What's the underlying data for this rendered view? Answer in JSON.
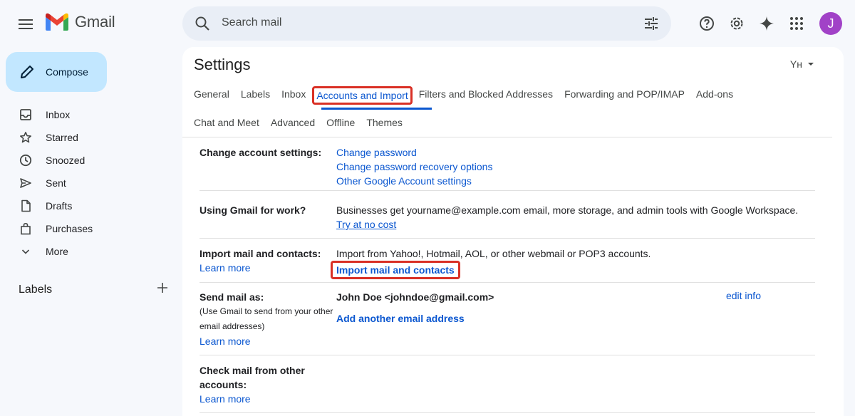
{
  "app": {
    "name": "Gmail",
    "avatar_initial": "J"
  },
  "search": {
    "placeholder": "Search mail"
  },
  "compose": {
    "label": "Compose"
  },
  "nav": [
    {
      "label": "Inbox",
      "icon": "inbox-icon"
    },
    {
      "label": "Starred",
      "icon": "star-icon"
    },
    {
      "label": "Snoozed",
      "icon": "clock-icon"
    },
    {
      "label": "Sent",
      "icon": "send-icon"
    },
    {
      "label": "Drafts",
      "icon": "draft-icon"
    },
    {
      "label": "Purchases",
      "icon": "bag-icon"
    },
    {
      "label": "More",
      "icon": "chevron-down-icon"
    }
  ],
  "labels_header": "Labels",
  "settings": {
    "title": "Settings",
    "lang_indicator": "Yн",
    "tabs_row1": [
      "General",
      "Labels",
      "Inbox",
      "Accounts and Import",
      "Filters and Blocked Addresses",
      "Forwarding and POP/IMAP",
      "Add-ons"
    ],
    "tabs_row2": [
      "Chat and Meet",
      "Advanced",
      "Offline",
      "Themes"
    ],
    "active_tab": "Accounts and Import",
    "sections": {
      "change_account": {
        "label": "Change account settings:",
        "links": [
          "Change password",
          "Change password recovery options",
          "Other Google Account settings"
        ]
      },
      "work": {
        "label": "Using Gmail for work?",
        "text": "Businesses get yourname@example.com email, more storage, and admin tools with Google Workspace.",
        "link": "Try at no cost"
      },
      "import": {
        "label": "Import mail and contacts:",
        "learn_more": "Learn more",
        "text": "Import from Yahoo!, Hotmail, AOL, or other webmail or POP3 accounts.",
        "action": "Import mail and contacts"
      },
      "send_as": {
        "label": "Send mail as:",
        "sub": "(Use Gmail to send from your other email addresses)",
        "learn_more": "Learn more",
        "identity": "John Doe <johndoe@gmail.com>",
        "edit": "edit info",
        "add": "Add another email address"
      },
      "check_mail": {
        "label": "Check mail from other accounts:",
        "learn_more": "Learn more"
      }
    }
  },
  "colors": {
    "accent": "#0b57d0",
    "highlight": "#d93025",
    "compose_bg": "#c2e7ff",
    "avatar": "#a142c7"
  }
}
